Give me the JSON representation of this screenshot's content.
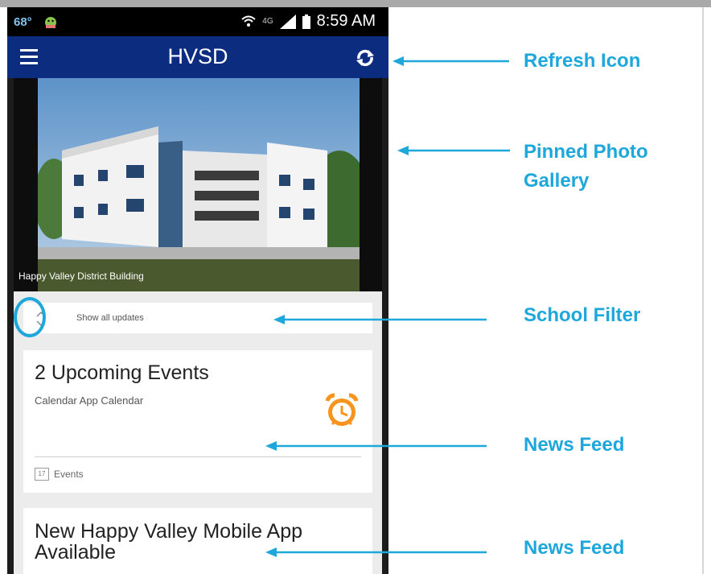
{
  "status_bar": {
    "temperature": "68°",
    "network": "4G",
    "time": "8:59 AM"
  },
  "app_bar": {
    "title": "HVSD",
    "menu_icon": "hamburger-menu-icon",
    "refresh_icon": "refresh-icon"
  },
  "gallery": {
    "caption": "Happy Valley District Building"
  },
  "filter": {
    "label": "Show all updates",
    "icon": "chevron-up-down-icon"
  },
  "feed": [
    {
      "title": "2 Upcoming Events",
      "subtitle": "Calendar App Calendar",
      "icon": "alarm-clock-icon",
      "footer_label": "Events",
      "footer_icon_text": "17"
    },
    {
      "title": "New Happy Valley Mobile App Available"
    }
  ],
  "annotations": {
    "refresh": "Refresh Icon",
    "gallery_line1": "Pinned Photo",
    "gallery_line2": "Gallery",
    "filter": "School Filter",
    "news1": "News Feed",
    "news2": "News Feed"
  },
  "colors": {
    "app_bar": "#0c2d7f",
    "annotation": "#1ea7db",
    "alarm": "#f7941d"
  }
}
